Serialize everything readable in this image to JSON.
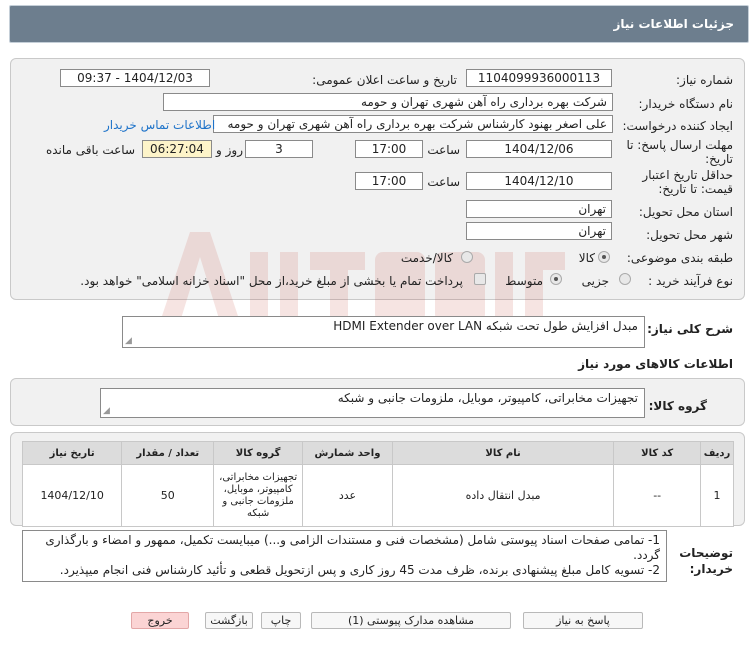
{
  "title": "جزئیات اطلاعات نیاز",
  "fields": {
    "need_number_label": "شماره نیاز:",
    "need_number": "1104099936000113",
    "announce_label": "تاریخ و ساعت اعلان عمومی:",
    "announce_value": "1404/12/03 - 09:37",
    "buyer_org_label": "نام دستگاه خریدار:",
    "buyer_org": "شرکت بهره برداری راه آهن شهری تهران و حومه",
    "creator_label": "ایجاد کننده درخواست:",
    "creator": "علی اصغر بهنود کارشناس شرکت بهره برداری راه آهن شهری تهران و حومه",
    "buyer_contact_link": "اطلاعات تماس خریدار",
    "reply_deadline_label": "مهلت ارسال پاسخ: تا تاریخ:",
    "reply_date": "1404/12/06",
    "time_label": "ساعت",
    "reply_time": "17:00",
    "days_value": "3",
    "days_label": "روز و",
    "remaining_time": "06:27:04",
    "remaining_label": "ساعت باقی مانده",
    "price_validity_label": "حداقل تاریخ اعتبار قیمت: تا تاریخ:",
    "validity_date": "1404/12/10",
    "validity_time": "17:00",
    "province_label": "استان محل تحویل:",
    "province": "تهران",
    "city_label": "شهر محل تحویل:",
    "city": "تهران",
    "category_label": "طبقه بندی موضوعی:",
    "category_goods": "کالا",
    "category_goods_service": "کالا/خدمت",
    "process_label": "نوع فرآیند خرید :",
    "process_small": "جزیی",
    "process_medium": "متوسط",
    "process_note": "پرداخت تمام یا بخشی از مبلغ خرید،از محل \"اسناد خزانه اسلامی\" خواهد بود."
  },
  "description": {
    "label": "شرح کلی نیاز:",
    "value": "مبدل افزایش طول تحت شبکه HDMI Extender over LAN"
  },
  "goods_info_heading": "اطلاعات کالاهای مورد نیاز",
  "goods_group": {
    "label": "گروه کالا:",
    "value": "تجهیزات مخابراتی، کامپیوتر، موبایل، ملزومات جانبی و شبکه"
  },
  "table": {
    "headers": [
      "ردیف",
      "کد کالا",
      "نام کالا",
      "واحد شمارش",
      "گروه کالا",
      "تعداد / مقدار",
      "تاریخ نیاز"
    ],
    "rows": [
      {
        "row": "1",
        "code": "--",
        "name": "مبدل انتقال داده",
        "unit": "عدد",
        "group": "تجهیزات مخابراتی، کامپیوتر، موبایل، ملزومات جانبی و شبکه",
        "qty": "50",
        "date": "1404/12/10"
      }
    ]
  },
  "buyer_notes": {
    "label": "توضیحات خریدار:",
    "line1": "1- تمامی صفحات اسناد پیوستی شامل (مشخصات فنی و مستندات الزامی و...) میبایست تکمیل، ممهور و امضاء و بارگذاری گردد.",
    "line2": "2- تسویه کامل مبلغ پیشنهادی برنده، ظرف مدت 45 روز کاری و پس ازتحویل قطعی و تأئید کارشناس فنی انجام میپذیرد."
  },
  "buttons": {
    "reply": "پاسخ به نیاز",
    "attachments": "مشاهده مدارک پیوستی (1)",
    "print": "چاپ",
    "back": "بازگشت",
    "exit": "خروج"
  },
  "colors": {
    "title_bar": "#6d7e8e",
    "highlight": "#fdf4c9",
    "link": "#1e73c9",
    "exit_button": "#fbd4d4"
  }
}
